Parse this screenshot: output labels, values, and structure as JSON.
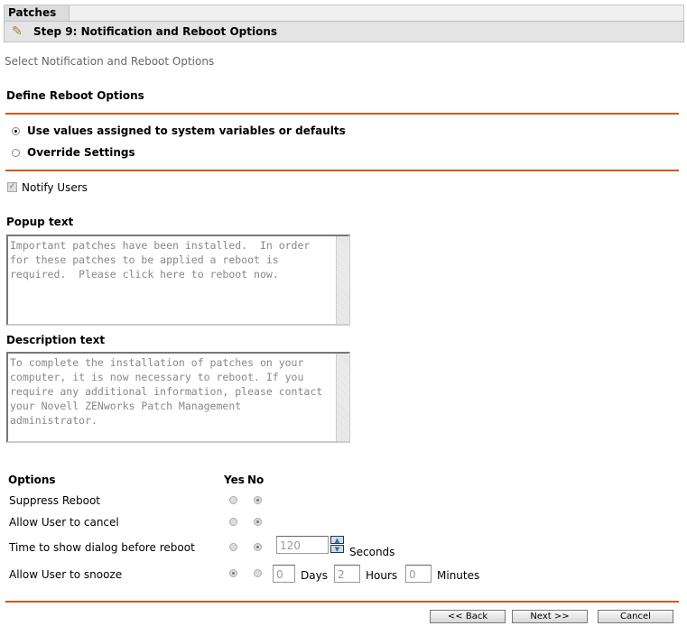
{
  "header": {
    "tab": "Patches",
    "step_title": "Step 9: Notification and Reboot Options"
  },
  "subtitle": "Select Notification and Reboot Options",
  "reboot": {
    "title": "Define Reboot Options",
    "option_defaults": "Use values assigned to system variables or defaults",
    "option_override": "Override Settings",
    "selected": "defaults"
  },
  "notify_users": {
    "label": "Notify Users",
    "checked": true
  },
  "popup": {
    "label": "Popup text",
    "value": "Important patches have been installed.  In order for these patches to be applied a reboot is required.  Please click here to reboot now."
  },
  "description": {
    "label": "Description text",
    "value": "To complete the installation of patches on your computer, it is now necessary to reboot. If you require any additional information, please contact your Novell ZENworks Patch Management administrator."
  },
  "options": {
    "header": "Options",
    "yes": "Yes",
    "no": "No",
    "rows": [
      {
        "label": "Suppress Reboot",
        "value": "no"
      },
      {
        "label": "Allow User to cancel",
        "value": "no"
      },
      {
        "label": "Time to show dialog before reboot",
        "value": "no",
        "seconds": "120",
        "seconds_label": "Seconds"
      },
      {
        "label": "Allow User to snooze",
        "value": "yes",
        "days": "0",
        "days_label": "Days",
        "hours": "2",
        "hours_label": "Hours",
        "minutes": "0",
        "minutes_label": "Minutes"
      }
    ]
  },
  "buttons": {
    "back": "<< Back",
    "next": "Next >>",
    "cancel": "Cancel"
  }
}
